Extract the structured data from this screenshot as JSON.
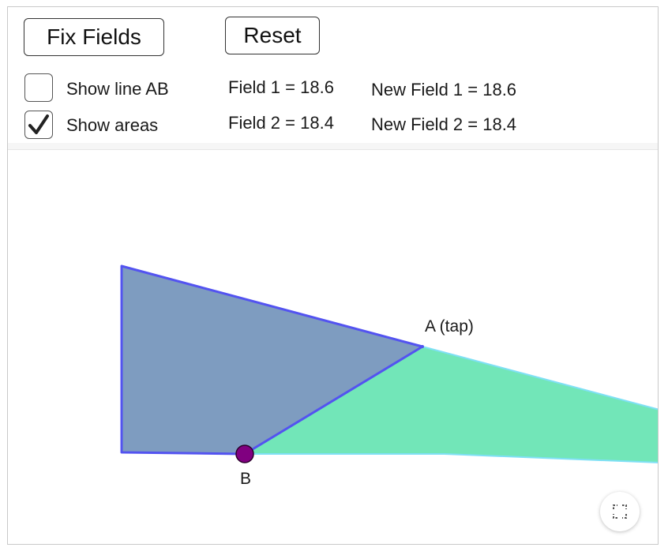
{
  "buttons": {
    "fix_fields": "Fix Fields",
    "reset": "Reset"
  },
  "checkboxes": {
    "show_line_ab": {
      "label": "Show line AB",
      "checked": false
    },
    "show_areas": {
      "label": "Show areas",
      "checked": true
    }
  },
  "stats": {
    "field1": "Field 1 = 18.6",
    "field2": "Field 2 = 18.4",
    "new_field1": "New Field 1 = 18.6",
    "new_field2": "New Field 2 = 18.4"
  },
  "canvas": {
    "point_a_label": "A (tap)",
    "point_b_label": "B"
  },
  "colors": {
    "field1_fill": "#7e9cc0",
    "field1_stroke": "#5353f0",
    "field2_fill": "#72e6b8",
    "field2_stroke": "#7fe0f5",
    "point_b": "#800080"
  },
  "icons": {
    "fullscreen": "fullscreen-icon",
    "checkmark": "checkmark-icon"
  }
}
